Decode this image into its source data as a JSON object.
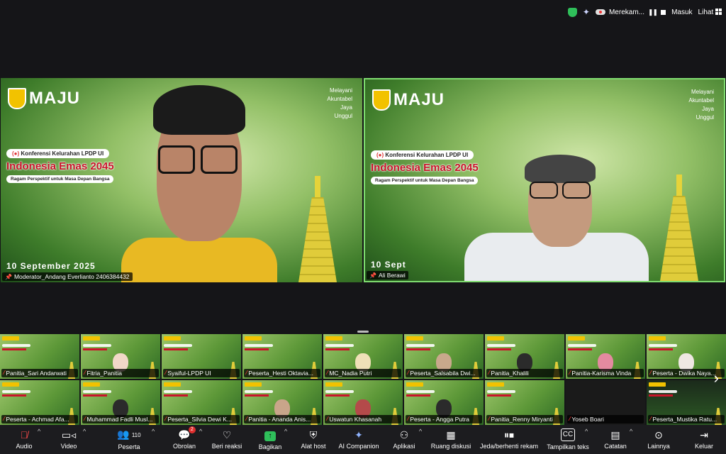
{
  "topbar": {
    "recording_label": "Merekam...",
    "signin_label": "Masuk",
    "view_label": "Lihat"
  },
  "slide": {
    "brand": "MAJU",
    "tagline": [
      "Melayani",
      "Akuntabel",
      "Jaya",
      "Unggul"
    ],
    "conference": "Konferensi Kelurahan LPDP UI",
    "title": "Indonesia Emas 2045",
    "subtitle": "Ragam Perspektif untuk Masa Depan Bangsa",
    "date_left": "10 September 2025",
    "date_right": "10 Sept"
  },
  "speakers": {
    "left_name": "Moderator_Andang Everlianto 2406384432",
    "right_name": "Ali Berawi"
  },
  "thumbnails": [
    {
      "name": "Panitia_Sari Andarwati",
      "muted": true
    },
    {
      "name": "Fitria_Panitia",
      "muted": true
    },
    {
      "name": "Syaiful-LPDP UI",
      "muted": true
    },
    {
      "name": "Peserta_Hesti Oktavia...",
      "muted": true
    },
    {
      "name": "MC_Nadia Putri",
      "muted": true
    },
    {
      "name": "Peserta_Salsabila Dwi...",
      "muted": true
    },
    {
      "name": "Panitia_Khalili",
      "muted": true
    },
    {
      "name": "Panitia-Karisma Vinda",
      "muted": true
    },
    {
      "name": "Peserta - Dwika Naya...",
      "muted": true
    },
    {
      "name": "Peserta - Achmad Afa...",
      "muted": true
    },
    {
      "name": "Muhammad Fadli Musl...",
      "muted": true
    },
    {
      "name": "Peserta_Silvia Dewi K...",
      "muted": true
    },
    {
      "name": "Panitia - Ananda Anis...",
      "muted": true
    },
    {
      "name": "Uswatun Khasanah",
      "muted": true
    },
    {
      "name": "Peserta - Angga Putra",
      "muted": true
    },
    {
      "name": "Panitia_Renny Miryanti",
      "muted": true
    },
    {
      "name": "Yoseb Boari",
      "muted": true
    },
    {
      "name": "Peserta_Mustika Ratu...",
      "muted": true
    }
  ],
  "toolbar": {
    "audio": "Audio",
    "video": "Video",
    "participants": "Peserta",
    "participants_count": "110",
    "chat": "Obrolan",
    "chat_badge": "2",
    "reactions": "Beri reaksi",
    "share": "Bagikan",
    "host_tools": "Alat host",
    "ai_companion": "AI Companion",
    "apps": "Aplikasi",
    "breakout": "Ruang diskusi",
    "pause_record": "Jeda/berhenti rekam",
    "captions": "Tampilkan teks",
    "notes": "Catatan",
    "more": "Lainnya",
    "leave": "Keluar"
  }
}
